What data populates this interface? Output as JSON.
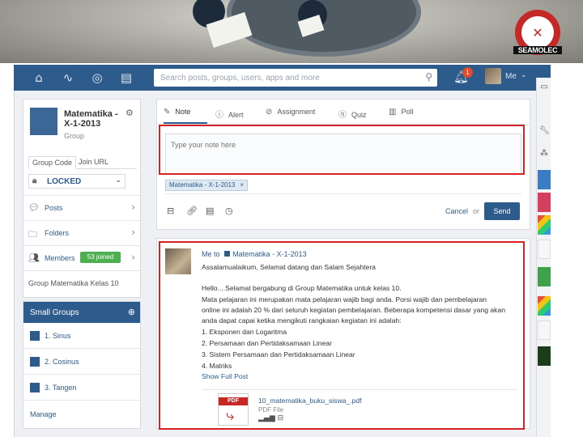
{
  "banner": {
    "logo_text": "SEAMOLEC"
  },
  "topbar": {
    "search_placeholder": "Search posts, groups, users, apps and more",
    "notification_count": "1",
    "user_label": "Me",
    "icons": [
      "home-icon",
      "activity-icon",
      "compass-icon",
      "book-icon"
    ]
  },
  "group": {
    "name": "Matematika - X-1-2013",
    "type": "Group",
    "tabs": [
      "Group Code",
      "Join URL"
    ],
    "lock_status": "LOCKED",
    "nav": [
      {
        "label": "Posts",
        "icon": "chat-icon"
      },
      {
        "label": "Folders",
        "icon": "folder-icon"
      },
      {
        "label": "Members",
        "icon": "members-icon",
        "badge": "53 joined"
      }
    ],
    "footer": "Group Matematika Kelas 10"
  },
  "small_groups": {
    "title": "Small Groups",
    "items": [
      "1. Sinus",
      "2. Cosinus",
      "3. Tangen"
    ],
    "manage": "Manage"
  },
  "composer": {
    "tabs": [
      {
        "label": "Note",
        "icon": "pencil-icon"
      },
      {
        "label": "Alert",
        "icon": "alert-icon"
      },
      {
        "label": "Assignment",
        "icon": "assignment-icon"
      },
      {
        "label": "Quiz",
        "icon": "quiz-icon"
      },
      {
        "label": "Poll",
        "icon": "poll-icon"
      }
    ],
    "placeholder": "Type your note here",
    "recipient": "Matematika - X-1-2013",
    "cancel": "Cancel",
    "or": "or",
    "send": "Send"
  },
  "post": {
    "author": "Me",
    "to": "to",
    "group": "Matematika - X-1-2013",
    "lines": [
      "Assalamualaikum, Selamat datang dan Salam Sejahtera",
      "",
      "Hello....Selamat bergabung di Group Matematika untuk kelas 10.",
      "Mata pelajaran ini merupakan mata pelajaran wajib bagi anda. Porsi wajib dan pembelajaran",
      "online ini adalah 20 % dari seluruh kegiatan pembelajaran. Beberapa kompetensi dasar yang akan",
      "anda dapat capai ketika mengikuti rangkaian kegiatan ini adalah:",
      "1. Eksponen dan Logaritma",
      "2. Persamaan dan Pertidaksamaan Linear",
      "3. Sistem Persamaan dan Pertidaksamaan Linear",
      "4. Matriks"
    ],
    "show_full": "Show Full Post",
    "attachment": {
      "filename": "10_matematika_buku_siswa_.pdf",
      "type": "PDF File",
      "badge": "PDF"
    }
  }
}
